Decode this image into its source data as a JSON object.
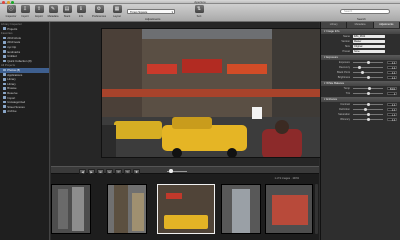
{
  "window": {
    "title": "Aperture"
  },
  "toolbar": {
    "buttons": [
      {
        "label": "Inspector",
        "icon": "inspector-icon"
      },
      {
        "label": "Import",
        "icon": "import-icon"
      },
      {
        "label": "Export",
        "icon": "export-icon"
      },
      {
        "label": "Metadata",
        "icon": "tag-icon"
      },
      {
        "label": "Stack",
        "icon": "stack-icon"
      },
      {
        "label": "Info",
        "icon": "info-icon"
      },
      {
        "label": "Preferences",
        "icon": "gear-icon"
      },
      {
        "label": "Layout",
        "icon": "layout-icon"
      },
      {
        "label": "Sort",
        "icon": "sort-icon"
      }
    ],
    "project_select": "Times Square",
    "adjustments_label": "Adjustments",
    "search_placeholder": "Search",
    "search_label": "Search"
  },
  "library": {
    "items": [
      {
        "label": "Library Inspector",
        "head": true
      },
      {
        "label": "Projects"
      },
      {
        "label": "Favorites",
        "head": true
      },
      {
        "label": "2010 shots"
      },
      {
        "label": "2010 tests"
      },
      {
        "label": "nyc trip"
      },
      {
        "label": "landmarks"
      },
      {
        "label": "Untitled"
      },
      {
        "label": "Quick Collection (8)"
      },
      {
        "label": "All Projects",
        "head": true
      },
      {
        "label": "Photos (8)",
        "selected": true
      },
      {
        "label": "Applications"
      },
      {
        "label": "Library"
      },
      {
        "label": "Library"
      },
      {
        "label": "Browse"
      },
      {
        "label": "Reserve"
      },
      {
        "label": "Import"
      },
      {
        "label": "Uncategorized"
      },
      {
        "label": "Street Scenes"
      },
      {
        "label": "Archive"
      }
    ]
  },
  "viewer": {
    "controls": [
      "◀",
      "▶",
      "⊞",
      "⊟",
      "↺",
      "↻",
      "✚"
    ],
    "strip_count": "1 of 9 images  ·  100%"
  },
  "inspector": {
    "tabs": [
      "Library",
      "Metadata",
      "Adjustments"
    ],
    "sections": [
      {
        "title": "Image Info",
        "rows": [
          {
            "label": "Name",
            "select": "IMG_0842"
          },
          {
            "label": "Version",
            "select": "Master"
          },
          {
            "label": "Size",
            "select": "Original"
          },
          {
            "label": "Preset",
            "select": "None"
          }
        ]
      },
      {
        "title": "Exposure",
        "rows": [
          {
            "label": "Exposure",
            "slider": 0.5,
            "value": "0.0"
          },
          {
            "label": "Recovery",
            "slider": 0.2,
            "value": "0.0"
          },
          {
            "label": "Black Point",
            "slider": 0.3,
            "value": "0.0"
          },
          {
            "label": "Brightness",
            "slider": 0.5,
            "value": "0.0"
          }
        ]
      },
      {
        "title": "White Balance",
        "rows": [
          {
            "label": "Temp",
            "slider": 0.55,
            "value": "5000"
          },
          {
            "label": "Tint",
            "slider": 0.5,
            "value": "0"
          }
        ]
      },
      {
        "title": "Enhance",
        "rows": [
          {
            "label": "Contrast",
            "slider": 0.5,
            "value": "0.0"
          },
          {
            "label": "Definition",
            "slider": 0.4,
            "value": "0.0"
          },
          {
            "label": "Saturation",
            "slider": 0.5,
            "value": "1.0"
          },
          {
            "label": "Vibrancy",
            "slider": 0.5,
            "value": "0.0"
          }
        ]
      }
    ]
  },
  "colors": {
    "selection": "#3e5f8f",
    "background": "#2b2b2b"
  }
}
